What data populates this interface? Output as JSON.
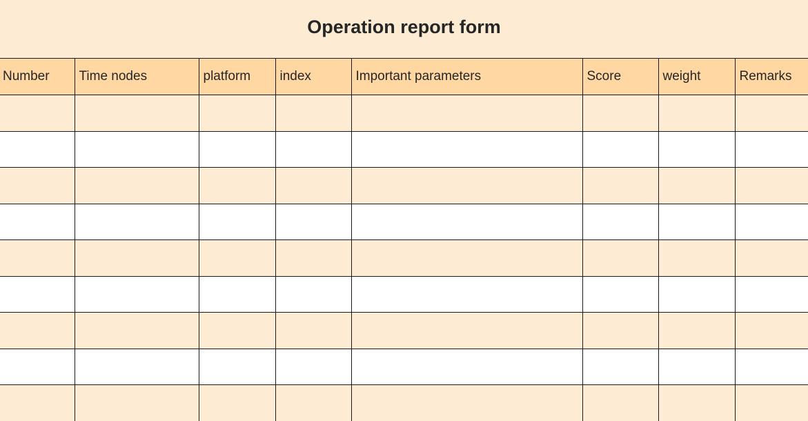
{
  "title": "Operation report form",
  "columns": [
    "Number",
    "Time nodes",
    "platform",
    "index",
    "Important parameters",
    "Score",
    "weight",
    "Remarks"
  ],
  "rows": [
    [
      "",
      "",
      "",
      "",
      "",
      "",
      "",
      ""
    ],
    [
      "",
      "",
      "",
      "",
      "",
      "",
      "",
      ""
    ],
    [
      "",
      "",
      "",
      "",
      "",
      "",
      "",
      ""
    ],
    [
      "",
      "",
      "",
      "",
      "",
      "",
      "",
      ""
    ],
    [
      "",
      "",
      "",
      "",
      "",
      "",
      "",
      ""
    ],
    [
      "",
      "",
      "",
      "",
      "",
      "",
      "",
      ""
    ],
    [
      "",
      "",
      "",
      "",
      "",
      "",
      "",
      ""
    ],
    [
      "",
      "",
      "",
      "",
      "",
      "",
      "",
      ""
    ],
    [
      "",
      "",
      "",
      "",
      "",
      "",
      "",
      ""
    ]
  ],
  "colors": {
    "page_background": "#fdebd3",
    "header_background": "#fed7a2",
    "alt_row_background": "#ffffff",
    "border": "#1a1a1a"
  }
}
